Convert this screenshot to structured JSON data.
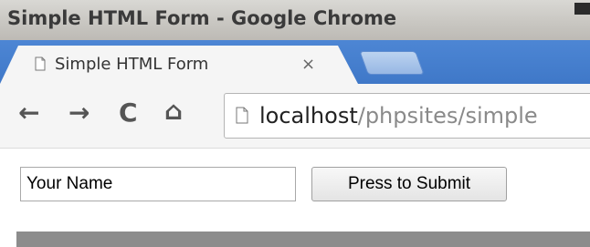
{
  "window": {
    "title": "Simple HTML Form - Google Chrome"
  },
  "tabs": [
    {
      "label": "Simple HTML Form",
      "close": "×"
    }
  ],
  "toolbar": {
    "back": "←",
    "forward": "→",
    "reload": "C",
    "home": "⌂"
  },
  "address_bar": {
    "host": "localhost",
    "path": "/phpsites/simple"
  },
  "form": {
    "name_input_value": "Your Name",
    "submit_label": "Press to Submit"
  },
  "colors": {
    "tab_strip": "#3f78c8",
    "toolbar": "#f5f5f5",
    "separator": "#8c8c8c"
  }
}
